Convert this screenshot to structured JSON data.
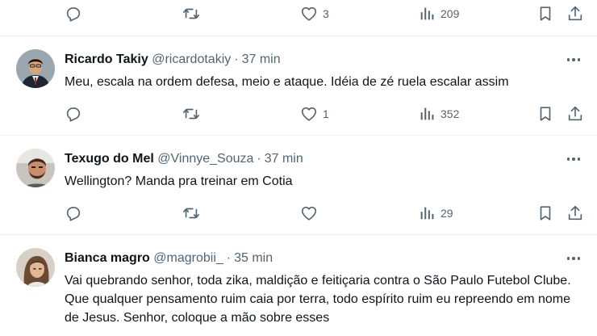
{
  "top_actions": {
    "reply_count": "",
    "retweet_count": "",
    "like_count": "3",
    "view_count": "209"
  },
  "tweets": [
    {
      "name": "Ricardo Takiy",
      "handle": "@ricardotakiy",
      "separator": "·",
      "time": "37 min",
      "text": "Meu, escala na ordem defesa, meio e ataque. Idéia de zé ruela escalar assim",
      "like_count": "1",
      "view_count": "352"
    },
    {
      "name": "Texugo do Mel",
      "handle": "@Vinnye_Souza",
      "separator": "·",
      "time": "37 min",
      "text": "Wellington? Manda pra treinar em Cotia",
      "like_count": "",
      "view_count": "29"
    },
    {
      "name": "Bianca magro",
      "handle": "@magrobii_",
      "separator": "·",
      "time": "35 min",
      "text": "Vai quebrando senhor, toda zika, maldição e feitiçaria contra o São Paulo Futebol Clube. Que qualquer pensamento ruim caia por terra, todo espírito ruim eu repreendo em nome de Jesus. Senhor, coloque a mão sobre esses",
      "like_count": "",
      "view_count": ""
    }
  ],
  "icons": {
    "reply": "reply-icon",
    "retweet": "retweet-icon",
    "like": "heart-icon",
    "views": "views-icon",
    "bookmark": "bookmark-icon",
    "share": "share-icon",
    "more": "more-icon"
  },
  "colors": {
    "text": "#0f1419",
    "secondary": "#536471",
    "divider": "#eff3f4"
  }
}
